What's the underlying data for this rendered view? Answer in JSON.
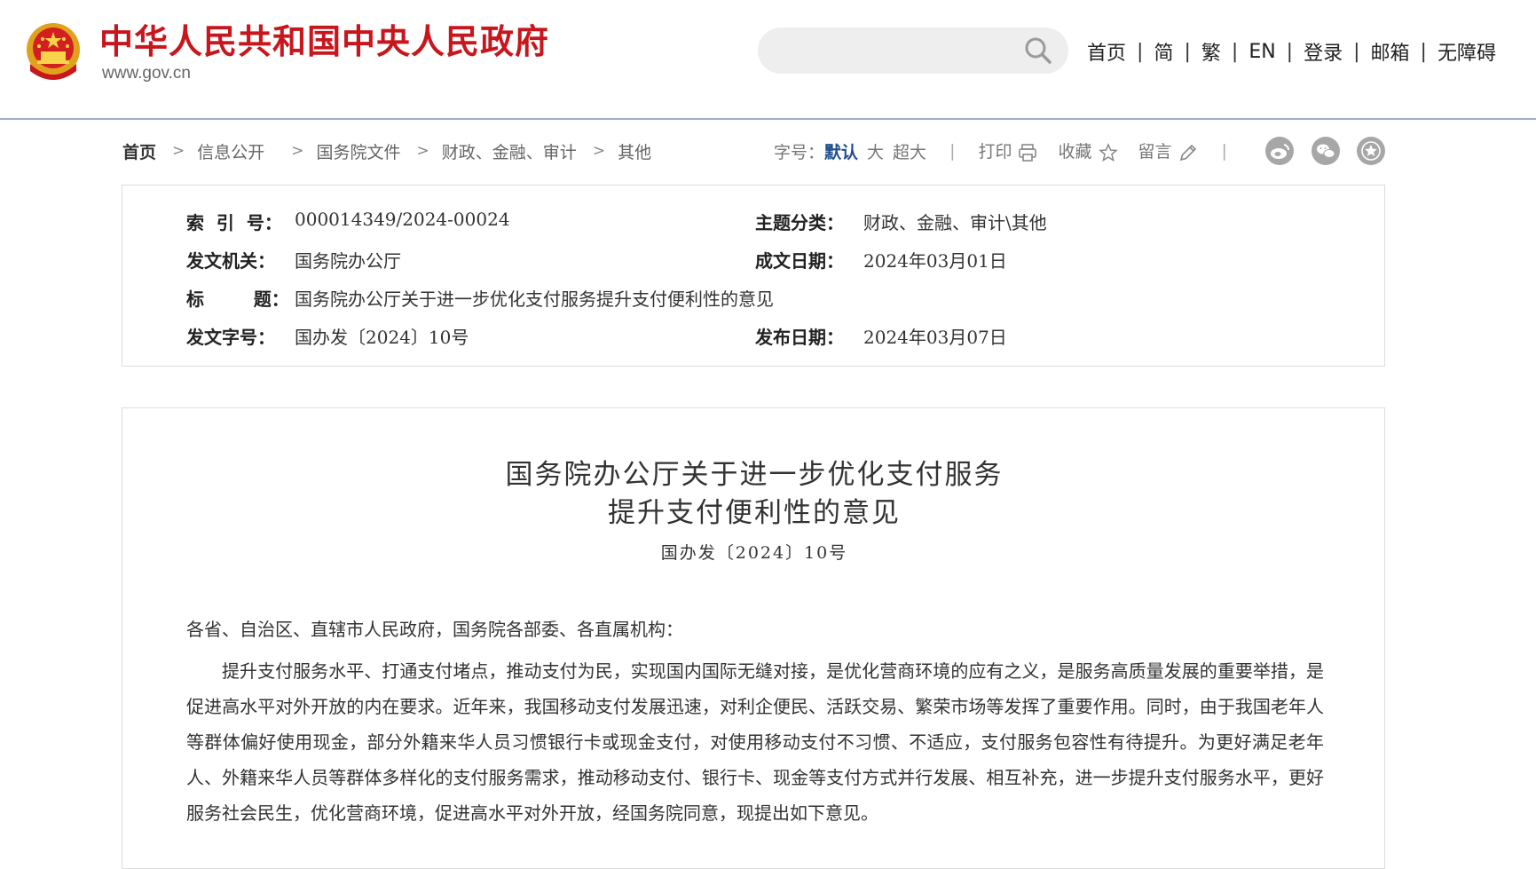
{
  "header": {
    "site_title": "中华人民共和国中央人民政府",
    "site_url": "www.gov.cn",
    "search": {
      "placeholder": ""
    },
    "nav": [
      "首页",
      "简",
      "繁",
      "EN",
      "登录",
      "邮箱",
      "无障碍"
    ],
    "separator": "|"
  },
  "breadcrumb": {
    "items": [
      "首页",
      "信息公开",
      "国务院文件",
      "财政、金融、审计",
      "其他"
    ],
    "chevron": ">"
  },
  "tools": {
    "font_size_label": "字号：",
    "font_sizes": [
      "默认",
      "大",
      "超大"
    ],
    "print": "打印",
    "favorite": "收藏",
    "comment": "留言"
  },
  "meta": {
    "index_no_label": "索  引  号：",
    "index_no": "000014349/2024-00024",
    "topic_label": "主题分类：",
    "topic": "财政、金融、审计\\其他",
    "issuer_label": "发文机关：",
    "issuer": "国务院办公厅",
    "created_label": "成文日期：",
    "created": "2024年03月01日",
    "title_label": "标        题：",
    "title": "国务院办公厅关于进一步优化支付服务提升支付便利性的意见",
    "doc_no_label": "发文字号：",
    "doc_no": "国办发〔2024〕10号",
    "published_label": "发布日期：",
    "published": "2024年03月07日"
  },
  "article": {
    "title_line1": "国务院办公厅关于进一步优化支付服务",
    "title_line2": "提升支付便利性的意见",
    "doc_no": "国办发〔2024〕10号",
    "greeting": "各省、自治区、直辖市人民政府，国务院各部委、各直属机构：",
    "paragraph1": "提升支付服务水平、打通支付堵点，推动支付为民，实现国内国际无缝对接，是优化营商环境的应有之义，是服务高质量发展的重要举措，是促进高水平对外开放的内在要求。近年来，我国移动支付发展迅速，对利企便民、活跃交易、繁荣市场等发挥了重要作用。同时，由于我国老年人等群体偏好使用现金，部分外籍来华人员习惯银行卡或现金支付，对使用移动支付不习惯、不适应，支付服务包容性有待提升。为更好满足老年人、外籍来华人员等群体多样化的支付服务需求，推动移动支付、银行卡、现金等支付方式并行发展、相互补充，进一步提升支付服务水平，更好服务社会民生，优化营商环境，促进高水平对外开放，经国务院同意，现提出如下意见。"
  },
  "colors": {
    "brand_red": "#c8161d",
    "link_blue": "#1f4e8e",
    "border_gray": "#dedede",
    "header_rule": "#9bb0c8"
  }
}
